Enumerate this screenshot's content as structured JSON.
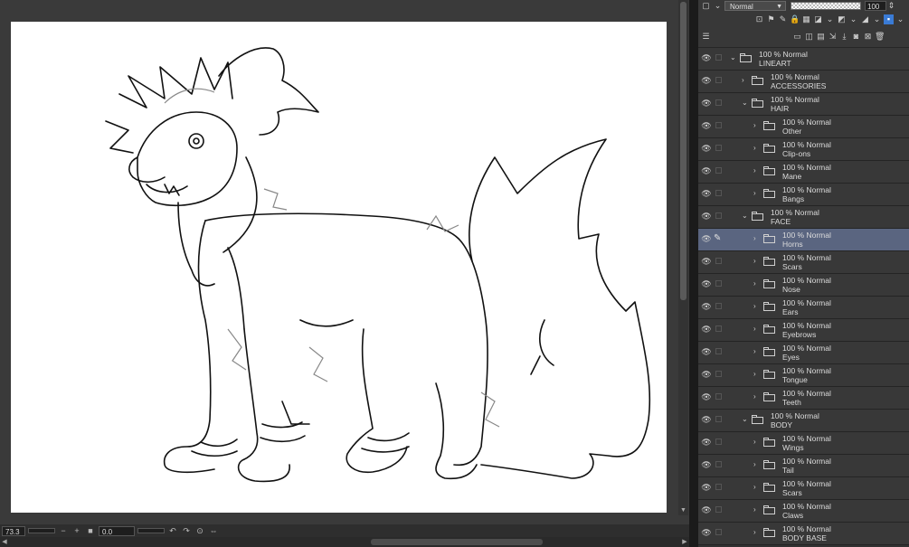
{
  "canvas": {
    "zoom": "73.3",
    "angle": "0.0"
  },
  "toolbar": {
    "blend_mode": "Normal",
    "opacity": "100"
  },
  "layers": [
    {
      "depth": 0,
      "info": "100 % Normal",
      "name": "LINEART",
      "open": true,
      "selected": false
    },
    {
      "depth": 1,
      "info": "100 % Normal",
      "name": "ACCESSORIES",
      "open": false,
      "selected": false
    },
    {
      "depth": 1,
      "info": "100 % Normal",
      "name": "HAIR",
      "open": true,
      "selected": false
    },
    {
      "depth": 2,
      "info": "100 % Normal",
      "name": "Other",
      "open": false,
      "selected": false
    },
    {
      "depth": 2,
      "info": "100 % Normal",
      "name": "Clip-ons",
      "open": false,
      "selected": false
    },
    {
      "depth": 2,
      "info": "100 % Normal",
      "name": "Mane",
      "open": false,
      "selected": false
    },
    {
      "depth": 2,
      "info": "100 % Normal",
      "name": "Bangs",
      "open": false,
      "selected": false
    },
    {
      "depth": 1,
      "info": "100 % Normal",
      "name": "FACE",
      "open": true,
      "selected": false
    },
    {
      "depth": 2,
      "info": "100 % Normal",
      "name": "Horns",
      "open": false,
      "selected": true
    },
    {
      "depth": 2,
      "info": "100 % Normal",
      "name": "Scars",
      "open": false,
      "selected": false
    },
    {
      "depth": 2,
      "info": "100 % Normal",
      "name": "Nose",
      "open": false,
      "selected": false
    },
    {
      "depth": 2,
      "info": "100 % Normal",
      "name": "Ears",
      "open": false,
      "selected": false
    },
    {
      "depth": 2,
      "info": "100 % Normal",
      "name": "Eyebrows",
      "open": false,
      "selected": false
    },
    {
      "depth": 2,
      "info": "100 % Normal",
      "name": "Eyes",
      "open": false,
      "selected": false
    },
    {
      "depth": 2,
      "info": "100 % Normal",
      "name": "Tongue",
      "open": false,
      "selected": false
    },
    {
      "depth": 2,
      "info": "100 % Normal",
      "name": "Teeth",
      "open": false,
      "selected": false
    },
    {
      "depth": 1,
      "info": "100 % Normal",
      "name": "BODY",
      "open": true,
      "selected": false
    },
    {
      "depth": 2,
      "info": "100 % Normal",
      "name": "Wings",
      "open": false,
      "selected": false
    },
    {
      "depth": 2,
      "info": "100 % Normal",
      "name": "Tail",
      "open": false,
      "selected": false
    },
    {
      "depth": 2,
      "info": "100 % Normal",
      "name": "Scars",
      "open": false,
      "selected": false
    },
    {
      "depth": 2,
      "info": "100 % Normal",
      "name": "Claws",
      "open": false,
      "selected": false
    },
    {
      "depth": 2,
      "info": "100 % Normal",
      "name": "BODY BASE",
      "open": false,
      "selected": false
    }
  ]
}
